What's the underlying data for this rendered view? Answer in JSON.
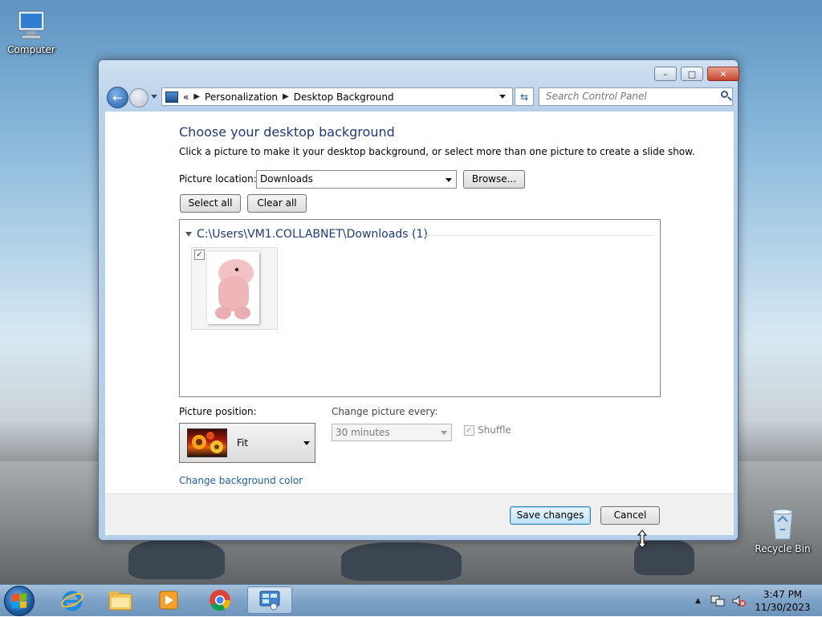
{
  "desktop": {
    "icons": [
      {
        "label": "Computer"
      },
      {
        "label": "Recycle Bin"
      }
    ]
  },
  "window": {
    "controls": {
      "minimize": "–",
      "maximize": "□",
      "close": "✕"
    },
    "address": {
      "prefix": "«",
      "crumbs": [
        "Personalization",
        "Desktop Background"
      ]
    },
    "search_placeholder": "Search Control Panel",
    "title": "Choose your desktop background",
    "subtitle": "Click a picture to make it your desktop background, or select more than one picture to create a slide show.",
    "picture_location_label": "Picture location:",
    "picture_location_value": "Downloads",
    "browse_label": "Browse...",
    "select_all_label": "Select all",
    "clear_all_label": "Clear all",
    "gallery": {
      "group_title": "C:\\Users\\VM1.COLLABNET\\Downloads (1)",
      "items": [
        {
          "checked": true
        }
      ]
    },
    "picture_position_label": "Picture position:",
    "picture_position_value": "Fit",
    "change_every_label": "Change picture every:",
    "change_every_value": "30 minutes",
    "shuffle_label": "Shuffle",
    "shuffle_checked": true,
    "change_color_link": "Change background color",
    "save_label": "Save changes",
    "cancel_label": "Cancel"
  },
  "taskbar": {
    "apps": [
      "internet-explorer-icon",
      "file-explorer-icon",
      "media-player-icon",
      "chrome-icon",
      "control-panel-icon"
    ],
    "clock": {
      "time": "3:47 PM",
      "date": "11/30/2023"
    }
  }
}
